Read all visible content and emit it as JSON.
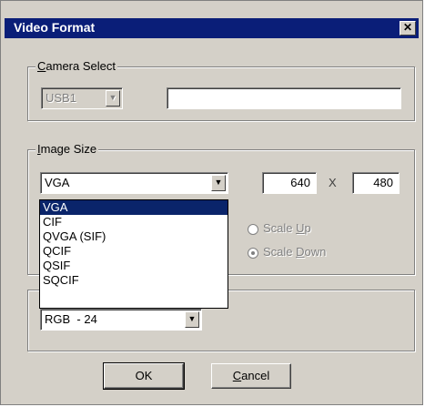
{
  "window": {
    "title": "Video Format",
    "close_glyph": "✕"
  },
  "camera_select": {
    "legend_hotkey": "C",
    "legend_rest": "amera Select",
    "device_value": "USB1",
    "device_text": ""
  },
  "image_size": {
    "legend_hotkey": "I",
    "legend_rest": "mage Size",
    "selected": "VGA",
    "width": "640",
    "separator": "X",
    "height": "480",
    "options": [
      "VGA",
      "CIF",
      "QVGA (SIF)",
      "QCIF",
      "QSIF",
      "SQCIF"
    ],
    "scale_up_pre": "Scale ",
    "scale_up_hot": "U",
    "scale_up_post": "p",
    "scale_down_pre": "Scale ",
    "scale_down_hot": "D",
    "scale_down_post": "own"
  },
  "color_format": {
    "selected": "RGB  - 24"
  },
  "buttons": {
    "ok": "OK",
    "cancel_hot": "C",
    "cancel_rest": "ancel"
  }
}
